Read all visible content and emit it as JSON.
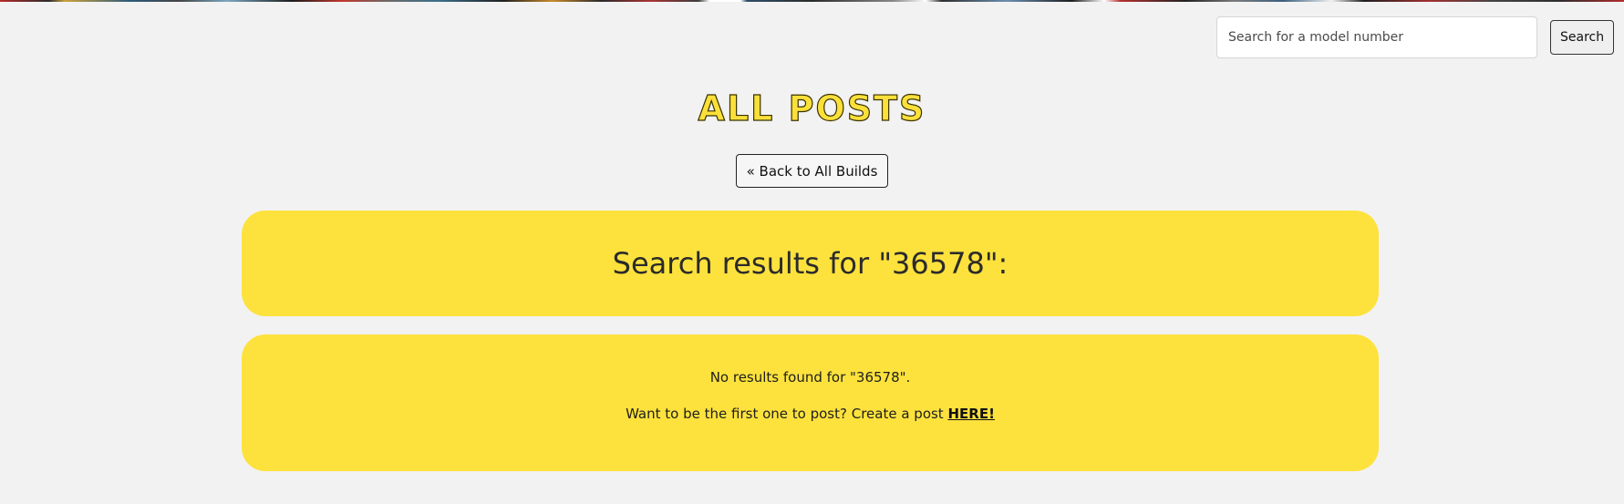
{
  "search": {
    "placeholder": "Search for a model number",
    "value": "",
    "button_label": "Search"
  },
  "header": {
    "title": "ALL POSTS",
    "back_label": "« Back to All Builds"
  },
  "results": {
    "heading": "Search results for \"36578\":",
    "no_results": "No results found for \"36578\".",
    "prompt": "Want to be the first one to post? Create a post",
    "link_label": "HERE!"
  },
  "colors": {
    "background": "#f2f2f2",
    "panel": "#fde23d",
    "title_fill": "#fce03a"
  }
}
